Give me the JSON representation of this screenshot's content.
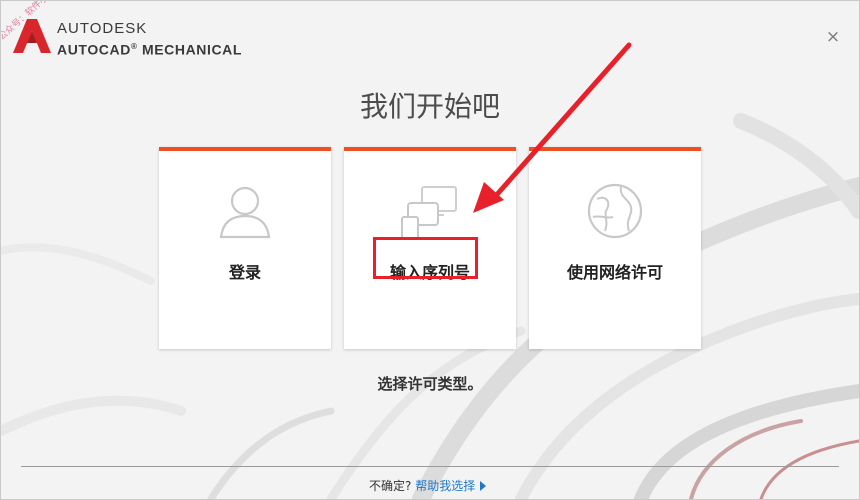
{
  "window": {
    "close_glyph": "×"
  },
  "brand": {
    "company": "AUTODESK",
    "product": "AUTOCAD MECHANICAL",
    "registered": "®",
    "logo_letter": "A"
  },
  "watermark": "公众号：软件小神",
  "title": "我们开始吧",
  "cards": [
    {
      "label": "登录",
      "icon": "person-icon"
    },
    {
      "label": "输入序列号",
      "icon": "devices-icon"
    },
    {
      "label": "使用网络许可",
      "icon": "globe-icon"
    }
  ],
  "subtitle": "选择许可类型。",
  "footer": {
    "question": "不确定?",
    "help_link": "帮助我选择"
  },
  "colors": {
    "accent": "#f04e23",
    "highlight": "#e8202a",
    "link": "#1f78c8",
    "logo_red": "#d9262c"
  }
}
